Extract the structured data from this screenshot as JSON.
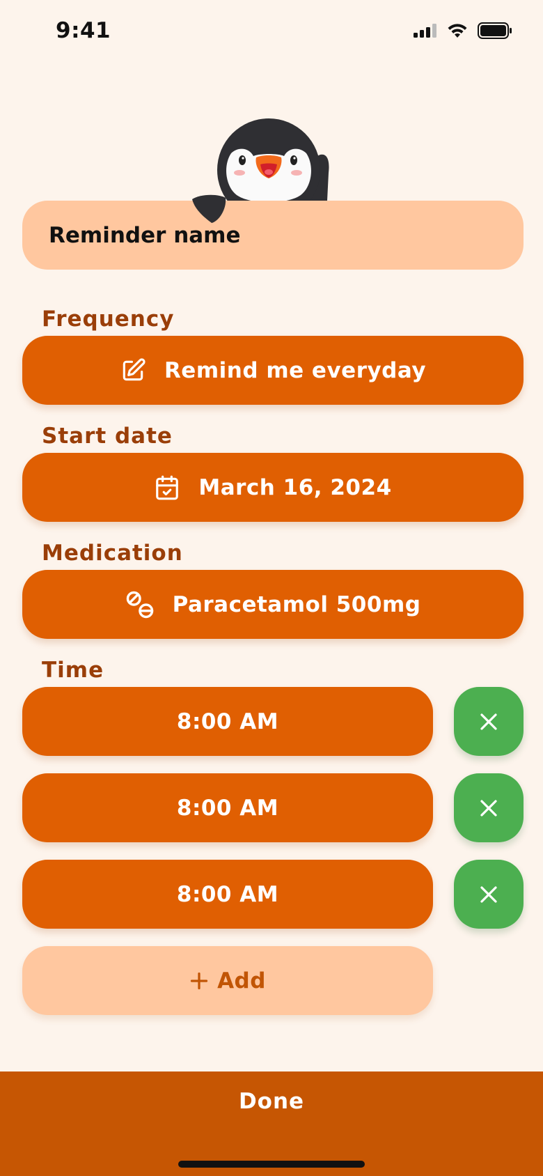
{
  "status_bar": {
    "time": "9:41",
    "icons": [
      "cellular-signal-icon",
      "wifi-icon",
      "battery-icon"
    ]
  },
  "mascot": {
    "icon": "penguin-mascot"
  },
  "reminder_name": {
    "placeholder": "Reminder name"
  },
  "frequency": {
    "label": "Frequency",
    "value": "Remind me everyday",
    "icon": "edit-icon"
  },
  "start_date": {
    "label": "Start date",
    "value": "March 16, 2024",
    "icon": "calendar-check-icon"
  },
  "medication": {
    "label": "Medication",
    "value": "Paracetamol 500mg",
    "icon": "pills-icon"
  },
  "time": {
    "label": "Time",
    "entries": [
      {
        "value": "8:00 AM"
      },
      {
        "value": "8:00 AM"
      },
      {
        "value": "8:00 AM"
      }
    ],
    "remove_icon": "close-icon",
    "add_label": "Add",
    "add_icon": "plus-icon"
  },
  "footer": {
    "done_label": "Done"
  },
  "colors": {
    "background": "#fdf4ec",
    "primary": "#e05f02",
    "primary_dark": "#c65603",
    "light_accent": "#ffc79f",
    "label": "#9a3e08",
    "remove": "#4caf50"
  }
}
